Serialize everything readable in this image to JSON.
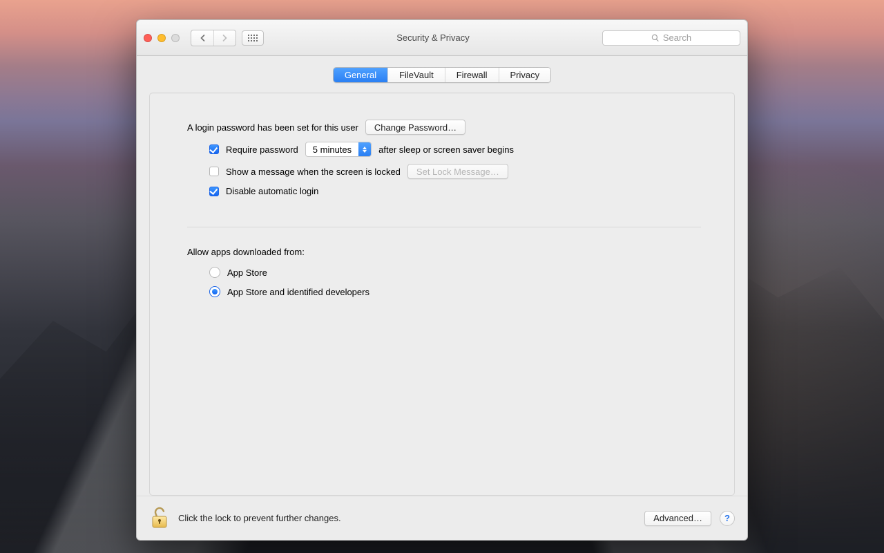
{
  "window": {
    "title": "Security & Privacy",
    "search_placeholder": "Search"
  },
  "tabs": {
    "general": "General",
    "filevault": "FileVault",
    "firewall": "Firewall",
    "privacy": "Privacy"
  },
  "login": {
    "heading": "A login password has been set for this user",
    "change_password_btn": "Change Password…",
    "require_password_label_pre": "Require password",
    "require_password_delay": "5 minutes",
    "require_password_label_post": "after sleep or screen saver begins",
    "show_message_label": "Show a message when the screen is locked",
    "set_lock_message_btn": "Set Lock Message…",
    "disable_auto_login_label": "Disable automatic login"
  },
  "gatekeeper": {
    "heading": "Allow apps downloaded from:",
    "opt_app_store": "App Store",
    "opt_app_store_dev": "App Store and identified developers"
  },
  "footer": {
    "lock_message": "Click the lock to prevent further changes.",
    "advanced_btn": "Advanced…",
    "help": "?"
  }
}
